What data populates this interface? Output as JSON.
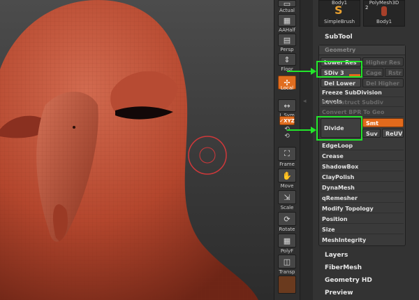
{
  "viewport": {
    "model_description_icon": "bird-head-sculpt",
    "brush_cursor_color": "#d0383a",
    "model_color": "#b4462d"
  },
  "shelf": {
    "items": [
      {
        "label": "Actual",
        "icon": "actual-icon"
      },
      {
        "label": "AAHalf",
        "icon": "aahalf-icon"
      },
      {
        "label": "Persp",
        "icon": "persp-icon"
      },
      {
        "label": "Floor",
        "icon": "floor-icon"
      },
      {
        "label": "Local",
        "icon": "local-icon"
      },
      {
        "label": "L.Sym",
        "icon": "lsym-icon"
      },
      {
        "label": "✓XYZ",
        "icon": "xyz-icon"
      },
      {
        "label": "Frame",
        "icon": "frame-icon"
      },
      {
        "label": "Move",
        "icon": "move-icon"
      },
      {
        "label": "Scale",
        "icon": "scale-icon"
      },
      {
        "label": "Rotate",
        "icon": "rotate-icon"
      },
      {
        "label": "PolyF",
        "icon": "polyf-icon"
      },
      {
        "label": "Transp",
        "icon": "transp-icon"
      }
    ]
  },
  "tool_palette": {
    "thumbs": [
      {
        "top_label": "Body1",
        "bottom_label": "SimpleBrush"
      },
      {
        "top_label": "PolyMesh3D",
        "bottom_label": "Body1",
        "badge": "2"
      }
    ],
    "subtool_title": "SubTool",
    "geometry": {
      "title": "Geometry",
      "lower_res": "Lower Res",
      "higher_res": "Higher Res",
      "sdiv": "SDiv 3",
      "cage": "Cage",
      "rstr": "Rstr",
      "del_lower": "Del Lower",
      "del_higher": "Del Higher",
      "freeze": "Freeze SubDivision Levels",
      "reconstruct": "Reconstruct Subdiv",
      "convert": "Convert BPR To Geo",
      "divide": "Divide",
      "smt": "Smt",
      "suv": "Suv",
      "reuv": "ReUV",
      "items": [
        "EdgeLoop",
        "Crease",
        "ShadowBox",
        "ClayPolish",
        "DynaMesh",
        "qRemesher",
        "Modify Topology",
        "Position",
        "Size",
        "MeshIntegrity"
      ]
    },
    "sections_below": [
      "Layers",
      "FiberMesh",
      "Geometry HD",
      "Preview"
    ]
  },
  "colors": {
    "accent_orange": "#e26a1c",
    "highlight_green": "#22e62a"
  }
}
